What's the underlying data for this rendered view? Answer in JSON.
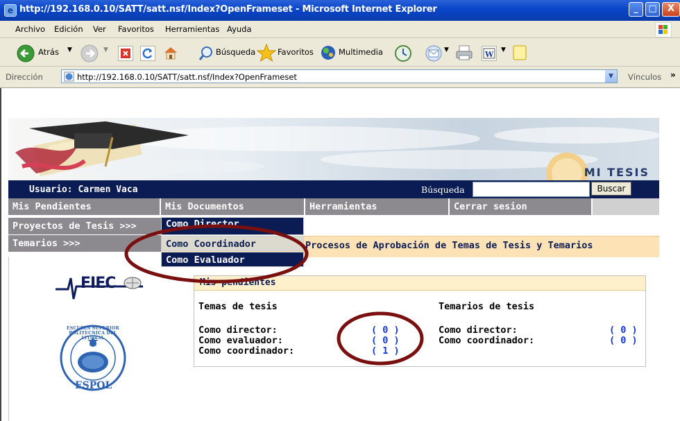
{
  "window": {
    "title": "http://192.168.0.10/SATT/satt.nsf/Index?OpenFrameset - Microsoft Internet Explorer",
    "buttons": {
      "minimize": "_",
      "maximize": "□",
      "close": "X"
    }
  },
  "menubar": {
    "items": [
      "Archivo",
      "Edición",
      "Ver",
      "Favoritos",
      "Herramientas",
      "Ayuda"
    ]
  },
  "toolbar": {
    "back_label": "Atrás",
    "search_label": "Búsqueda",
    "favorites_label": "Favoritos",
    "media_label": "Multimedia"
  },
  "addressbar": {
    "label": "Dirección",
    "url": "http://192.168.0.10/SATT/satt.nsf/Index?OpenFrameset",
    "links_label": "Vínculos",
    "links_more": "»"
  },
  "site": {
    "banner_logo_text": "MI TESIS",
    "user_label": "Usuario: Carmen Vaca",
    "search_label": "Búsqueda",
    "search_value": "",
    "search_button": "Buscar",
    "nav": [
      "Mis Pendientes",
      "Mis Documentos",
      "Herramientas",
      "Cerrar sesion"
    ],
    "sub_left": [
      "Proyectos de Tesis >>>",
      "Temarios >>>"
    ],
    "dropdown": [
      "Como Director",
      "Como Coordinador",
      "Como Evaluador"
    ],
    "process_title": "Procesos de Aprobación de Temas de Tesis y Temarios",
    "fiec_logo": "FIEC",
    "espol_seal_text": "ESCUELA SUPERIOR POLITECNICA DEL LITORAL",
    "espol_label": "ESPOL"
  },
  "panel": {
    "title": "Mis pendientes",
    "temas": {
      "heading": "Temas de tesis",
      "rows": [
        {
          "label": "Como director:",
          "count": "( 0 )"
        },
        {
          "label": "Como evaluador:",
          "count": "( 0 )"
        },
        {
          "label": "Como coordinador:",
          "count": "( 1 )"
        }
      ]
    },
    "temarios": {
      "heading": "Temarios de tesis",
      "rows": [
        {
          "label": "Como director:",
          "count": "( 0 )"
        },
        {
          "label": "Como coordinador:",
          "count": "( 0 )"
        }
      ]
    }
  },
  "colors": {
    "titlebar": "#0b47c9",
    "nav_dark": "#0b1c54",
    "nav_gray": "#8c8a8f",
    "process_bar": "#fde2b6",
    "count_blue": "#1436d8",
    "annotation": "#7a0f0f"
  }
}
